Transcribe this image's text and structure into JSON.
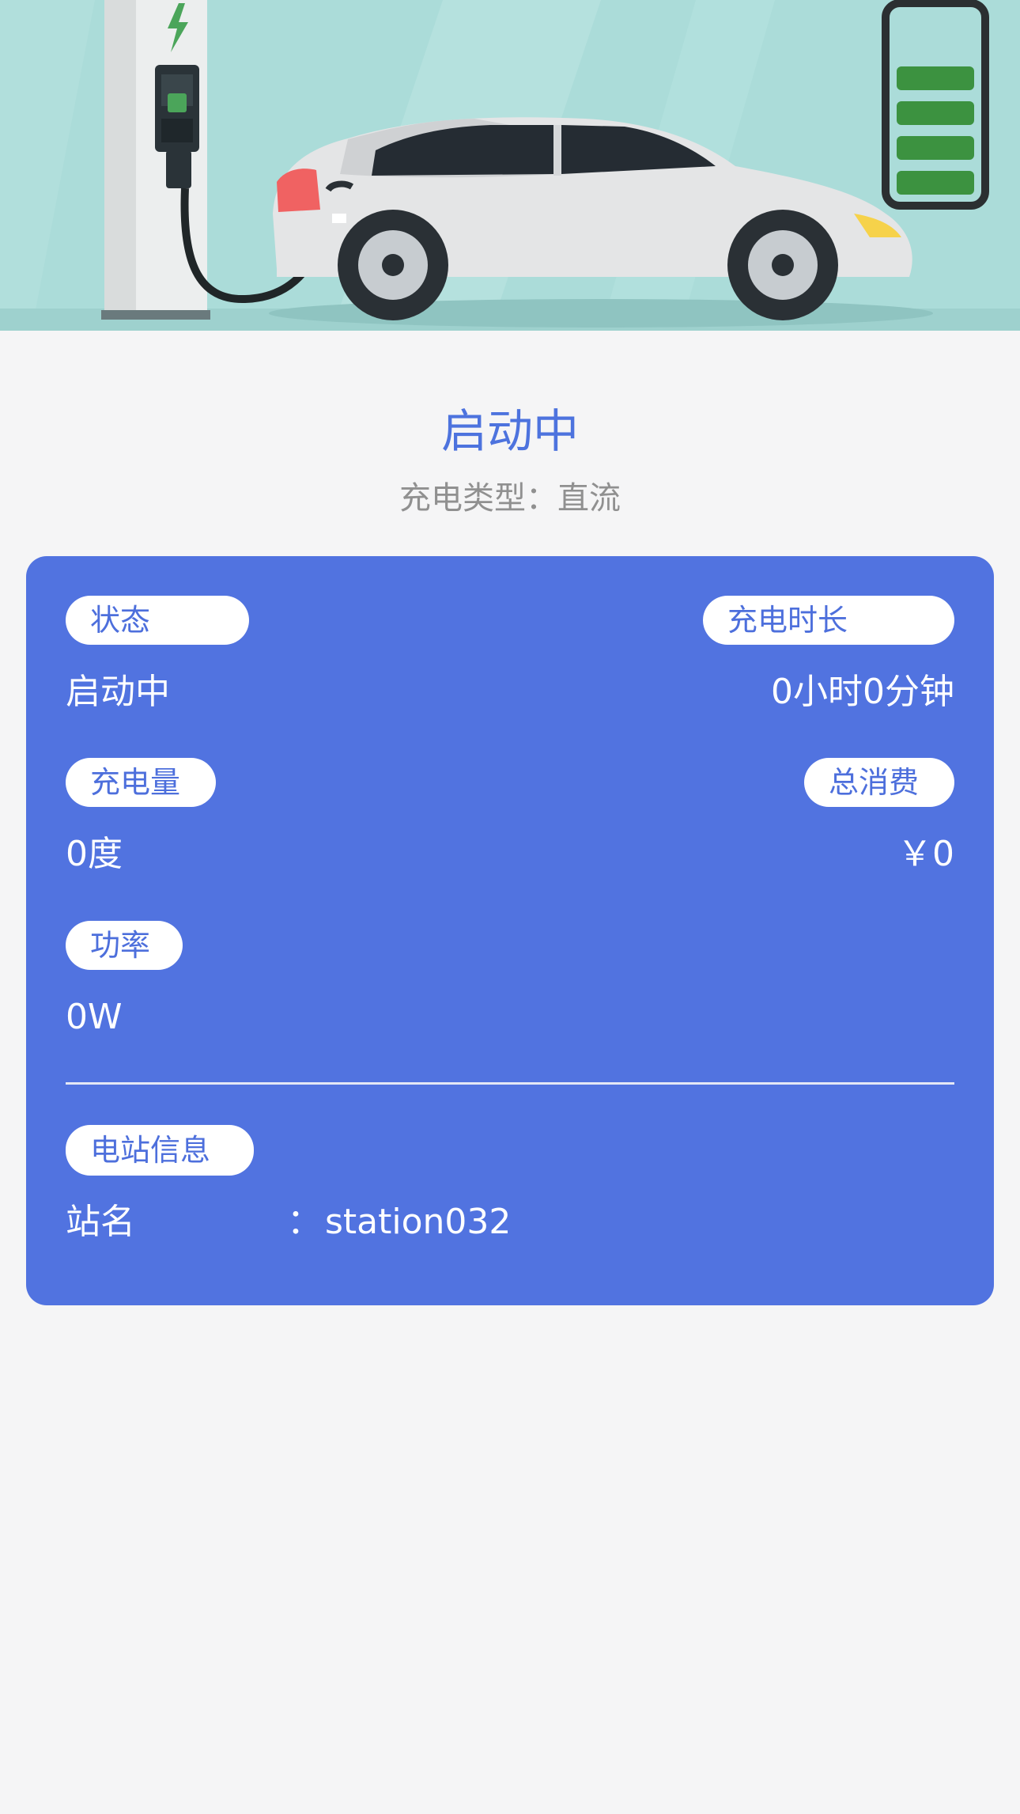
{
  "header": {
    "status": "启动中",
    "charge_type": "充电类型：直流"
  },
  "card": {
    "status_label": "状态",
    "status_value": "启动中",
    "duration_label": "充电时长",
    "duration_value": "0小时0分钟",
    "energy_label": "充电量",
    "energy_value": "0度",
    "cost_label": "总消费",
    "cost_value": "￥0",
    "power_label": "功率",
    "power_value": "0W",
    "station_section_label": "电站信息",
    "station_name_key": "站名",
    "station_name_sep": "：",
    "station_name_value": "station032"
  },
  "colors": {
    "accent": "#5173e0",
    "title": "#4d73de",
    "muted": "#909090",
    "background": "#f5f5f6",
    "battery_green": "#3c9240"
  },
  "banner": {
    "icons": [
      "charging-station-icon",
      "lightning-icon",
      "electric-car-icon",
      "battery-icon"
    ],
    "battery_level": 1.0
  }
}
